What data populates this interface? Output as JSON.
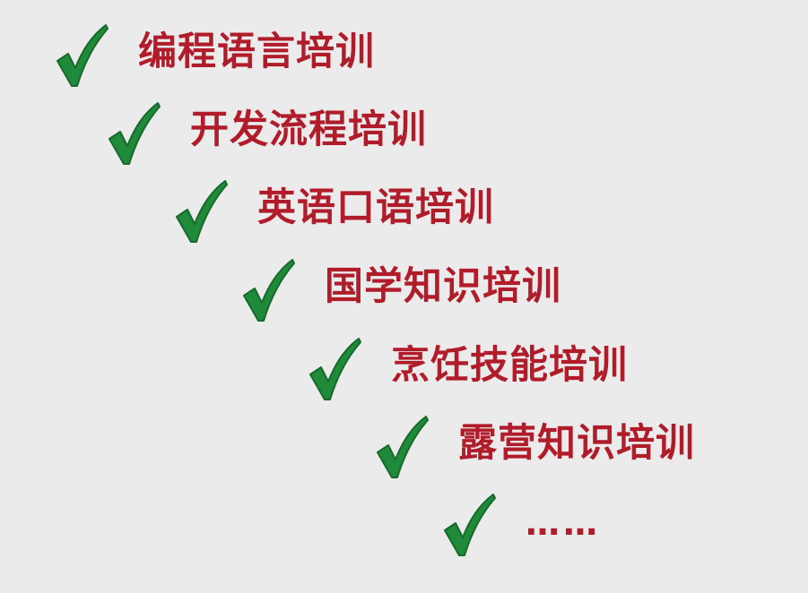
{
  "colors": {
    "background": "#ebebeb",
    "text": "#b01c2a",
    "check_fill": "#1f8a3a",
    "check_outline": "#176a2c"
  },
  "items": [
    {
      "label": "编程语言培训",
      "icon": "checkmark-icon"
    },
    {
      "label": "开发流程培训",
      "icon": "checkmark-icon"
    },
    {
      "label": "英语口语培训",
      "icon": "checkmark-icon"
    },
    {
      "label": "国学知识培训",
      "icon": "checkmark-icon"
    },
    {
      "label": "烹饪技能培训",
      "icon": "checkmark-icon"
    },
    {
      "label": "露营知识培训",
      "icon": "checkmark-icon"
    },
    {
      "label": "……",
      "icon": "checkmark-icon"
    }
  ]
}
